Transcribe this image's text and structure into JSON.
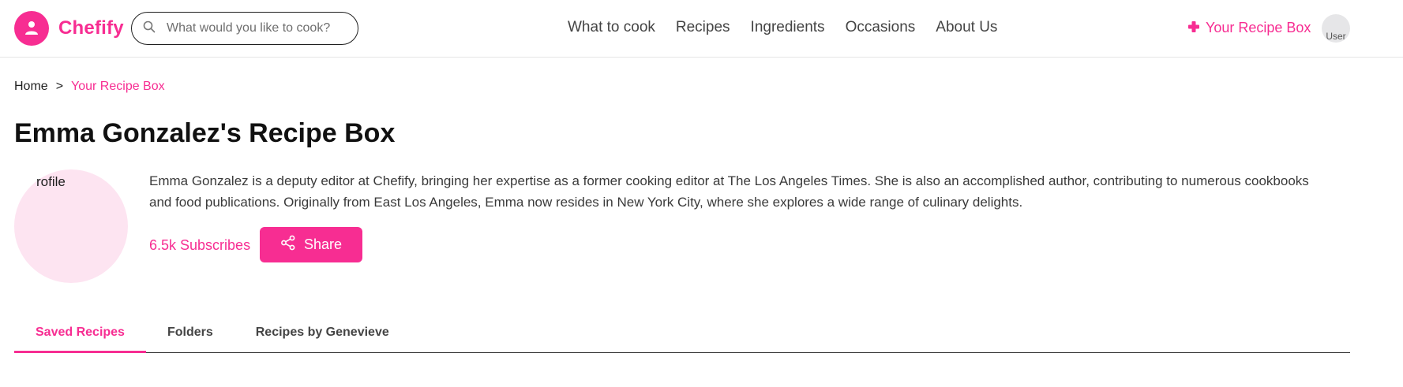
{
  "brand": {
    "name": "Chefify",
    "color": "#f72d92"
  },
  "search": {
    "placeholder": "What would you like to cook?",
    "value": ""
  },
  "nav": {
    "items": [
      {
        "label": "What to cook"
      },
      {
        "label": "Recipes"
      },
      {
        "label": "Ingredients"
      },
      {
        "label": "Occasions"
      },
      {
        "label": "About Us"
      }
    ]
  },
  "header": {
    "recipe_box_label": "Your Recipe Box",
    "user_avatar_alt": "User"
  },
  "breadcrumb": {
    "home": "Home",
    "separator": ">",
    "current": "Your Recipe Box"
  },
  "page": {
    "title": "Emma Gonzalez's Recipe Box",
    "profile_alt": "rofile",
    "bio": "Emma Gonzalez is a deputy editor at Chefify, bringing her expertise as a former cooking editor at The Los Angeles Times. She is also an accomplished author, contributing to numerous cookbooks and food publications. Originally from East Los Angeles, Emma now resides in New York City, where she explores a wide range of culinary delights.",
    "subscribers": "6.5k Subscribes",
    "share_label": "Share"
  },
  "tabs": [
    {
      "label": "Saved Recipes",
      "active": true
    },
    {
      "label": "Folders",
      "active": false
    },
    {
      "label": "Recipes by Genevieve",
      "active": false
    }
  ],
  "icons": {
    "logo": "chef-person-icon",
    "search": "search-icon",
    "plus": "plus-icon",
    "share": "share-icon"
  }
}
